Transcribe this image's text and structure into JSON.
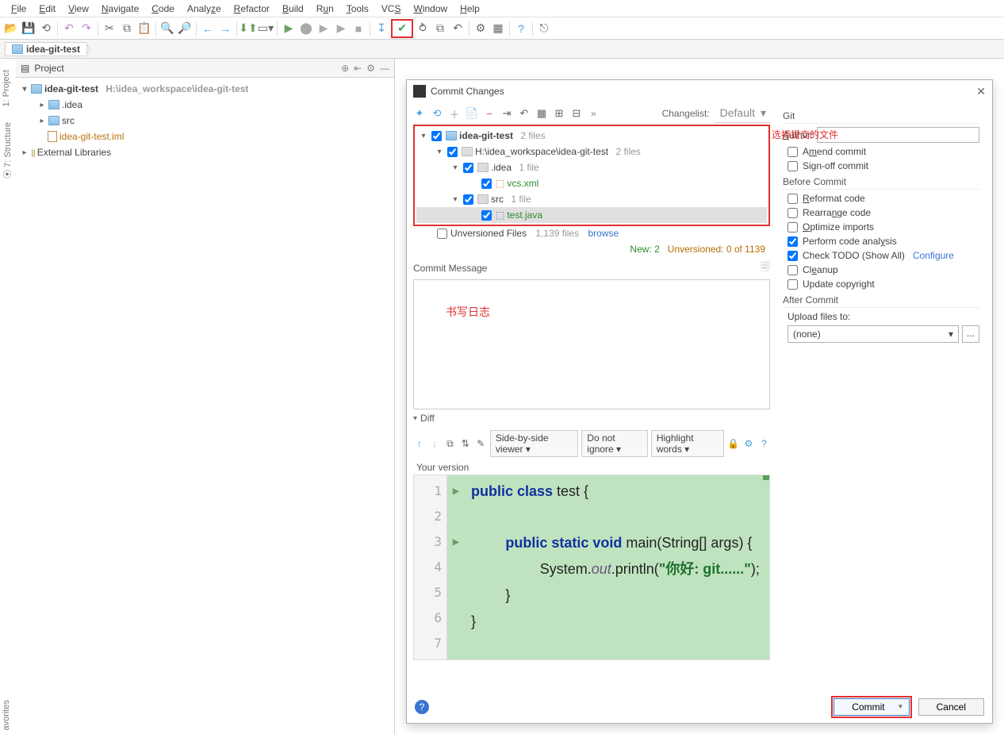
{
  "menu": {
    "file": "File",
    "edit": "Edit",
    "view": "View",
    "navigate": "Navigate",
    "code": "Code",
    "analyze": "Analyze",
    "refactor": "Refactor",
    "build": "Build",
    "run": "Run",
    "tools": "Tools",
    "vcs": "VCS",
    "window": "Window",
    "help": "Help"
  },
  "breadcrumb": {
    "project": "idea-git-test"
  },
  "sidetabs": {
    "project": "1: Project",
    "structure": "7: Structure",
    "favorites": "avorites"
  },
  "projectPanel": {
    "title": "Project",
    "root": "idea-git-test",
    "rootPath": "H:\\idea_workspace\\idea-git-test",
    "idea": ".idea",
    "src": "src",
    "iml": "idea-git-test.iml",
    "ext": "External Libraries"
  },
  "dialog": {
    "title": "Commit Changes",
    "changelistLabel": "Changelist:",
    "changelist": "Default",
    "annotation": "选择提交的文件",
    "tree": {
      "root": "idea-git-test",
      "rootInfo": "2 files",
      "ws": "H:\\idea_workspace\\idea-git-test",
      "wsInfo": "2 files",
      "idea": ".idea",
      "ideaInfo": "1 file",
      "vcs": "vcs.xml",
      "src": "src",
      "srcInfo": "1 file",
      "test": "test.java"
    },
    "unversioned": {
      "label": "Unversioned Files",
      "count": "1,139 files",
      "browse": "browse"
    },
    "stats": {
      "new": "New: 2",
      "unv": "Unversioned: 0 of 1139"
    },
    "commitMsg": {
      "label": "Commit Message",
      "placeholder": "书写日志"
    },
    "diff": {
      "label": "Diff",
      "viewer": "Side-by-side viewer",
      "ignore": "Do not ignore",
      "hl": "Highlight words",
      "your": "Your version"
    },
    "code": {
      "l1a": "public class ",
      "l1b": "test {",
      "l3a": "public static void ",
      "l3b": "main(String[] args) {",
      "l4a": "System.",
      "l4b": "out",
      "l4c": ".println(",
      "l4d": "\"你好: git......\"",
      "l4e": ");",
      "l5": "}",
      "l6": "}"
    },
    "right": {
      "git": "Git",
      "author": "Author:",
      "amend": "Amend commit",
      "signoff": "Sign-off commit",
      "before": "Before Commit",
      "reformat": "Reformat code",
      "rearrange": "Rearrange code",
      "optimize": "Optimize imports",
      "analysis": "Perform code analysis",
      "todo": "Check TODO (Show All)",
      "configure": "Configure",
      "cleanup": "Cleanup",
      "copyright": "Update copyright",
      "after": "After Commit",
      "upload": "Upload files to:",
      "uploadVal": "(none)",
      "dots": "..."
    },
    "buttons": {
      "commit": "Commit",
      "cancel": "Cancel"
    }
  }
}
